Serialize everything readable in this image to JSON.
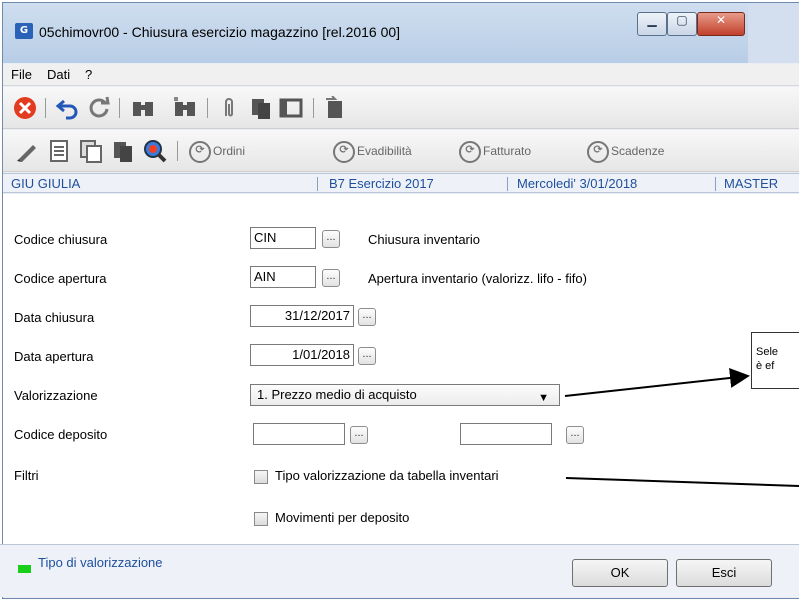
{
  "window": {
    "app_icon_text": "G",
    "title": "05chimovr00 - Chiusura esercizio magazzino  [rel.2016 00]",
    "min_glyph": "▁",
    "max_glyph": "▢",
    "close_glyph": "✕"
  },
  "menu": {
    "items": [
      "File",
      "Dati",
      "?"
    ]
  },
  "toolbar1": {
    "icons": [
      "close-circle-icon",
      "undo-icon",
      "refresh-icon",
      "binoculars-icon",
      "binoculars-advanced-icon",
      "paperclip-icon",
      "copy-pages-icon",
      "window-panel-icon",
      "export-icon"
    ]
  },
  "toolbar2": {
    "icons": [
      "pencil-icon",
      "document-icon",
      "multi-document-icon",
      "copy-icon",
      "zoom-person-icon"
    ],
    "buttons": [
      "Ordini",
      "Evadibilità",
      "Fatturato",
      "Scadenze"
    ]
  },
  "status": {
    "user": "GIU GIULIA",
    "exercise": "B7 Esercizio 2017",
    "date": "Mercoledi'  3/01/2018",
    "db": "MASTER"
  },
  "form": {
    "codice_chiusura": {
      "label": "Codice chiusura",
      "value": "CIN",
      "desc": "Chiusura inventario"
    },
    "codice_apertura": {
      "label": "Codice apertura",
      "value": "AIN",
      "desc": "Apertura inventario (valorizz. lifo - fifo)"
    },
    "data_chiusura": {
      "label": "Data chiusura",
      "value": "31/12/2017"
    },
    "data_apertura": {
      "label": "Data apertura",
      "value": "1/01/2018"
    },
    "valorizzazione": {
      "label": "Valorizzazione",
      "value": "1. Prezzo medio di acquisto"
    },
    "codice_deposito": {
      "label": "Codice deposito",
      "value_from": "",
      "value_to": ""
    },
    "filtri": {
      "label": "Filtri",
      "option1": "Tipo valorizzazione da tabella inventari",
      "option2": "Movimenti per deposito"
    },
    "dots": "..."
  },
  "callout": {
    "line1": "Sele",
    "line2": "è ef"
  },
  "footer": {
    "legend_color": "#17d017",
    "legend_text": "Tipo di valorizzazione",
    "ok_label": "OK",
    "esci_label": "Esci"
  }
}
